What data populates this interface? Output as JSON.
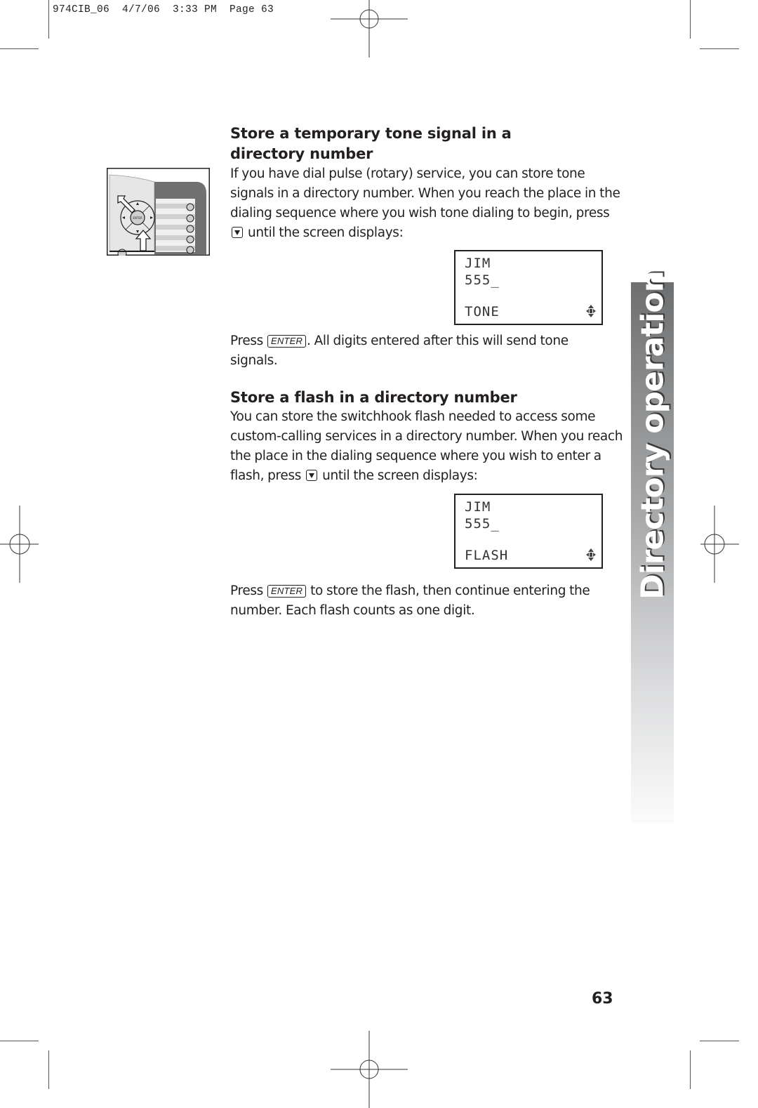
{
  "print_slug": {
    "text": "974CIB_06  4/7/06  3:33 PM  Page 63"
  },
  "section_tab": {
    "label": "Directory operation"
  },
  "sections": [
    {
      "heading": "Store a temporary tone signal in a directory number",
      "intro": {
        "before_key": "If you have dial pulse (rotary) service, you can store tone signals in a directory number. When you reach the place in the dialing sequence where you wish tone dialing to begin, press",
        "key_icon": "down-arrow-key",
        "after_key": "until the screen displays:"
      },
      "screen": {
        "line1": "JIM",
        "line2": "555_",
        "line3": "TONE",
        "indicator_icon": "navigation-arrows"
      },
      "followup": {
        "before_key": "Press",
        "key_label": "ENTER",
        "after_key": ". All digits entered after this will send tone signals."
      }
    },
    {
      "heading": "Store a flash in a directory number",
      "intro": {
        "before_key": "You can store the switchhook flash needed to access some custom-calling services in a directory number. When you reach the place in the dialing sequence where you wish to enter a flash,  press",
        "key_icon": "down-arrow-key",
        "after_key": "until the screen displays:"
      },
      "screen": {
        "line1": "JIM",
        "line2": "555_",
        "line3": "FLASH",
        "indicator_icon": "navigation-arrows"
      },
      "followup": {
        "before_key": "Press",
        "key_label": "ENTER",
        "after_key": "to store the flash, then continue entering the number.  Each flash counts as one digit."
      }
    }
  ],
  "illustration": {
    "description": "phone keypad with ENTER and down-arrow buttons highlighted",
    "center_button_label": "ENTER"
  },
  "page_number": "63"
}
